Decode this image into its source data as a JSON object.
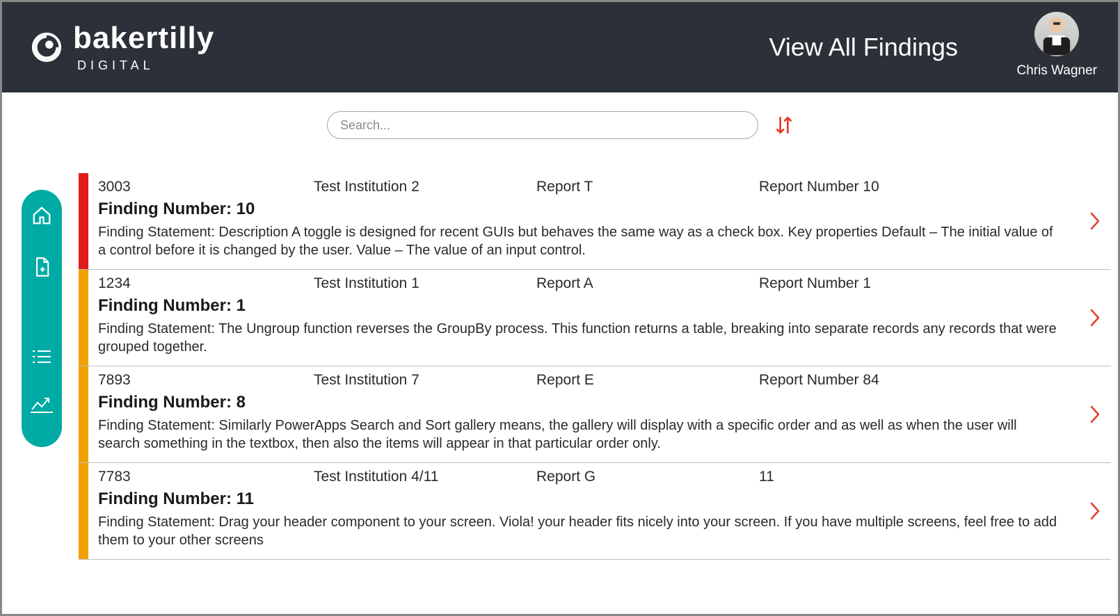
{
  "brand": {
    "name": "bakertilly",
    "sub": "DIGITAL"
  },
  "page_title": "View All Findings",
  "user": {
    "name": "Chris Wagner"
  },
  "search": {
    "placeholder": "Search..."
  },
  "findings": [
    {
      "status_color": "red",
      "id": "3003",
      "institution": "Test Institution 2",
      "report": "Report T",
      "report_number": "Report Number 10",
      "finding_number": "Finding Number: 10",
      "statement": "Finding Statement:  Description A toggle is designed for recent GUIs but behaves the same way as a check box.  Key properties Default – The initial value of a control before it is changed by the user.  Value – The value of an input control."
    },
    {
      "status_color": "orange",
      "id": "1234",
      "institution": "Test Institution 1",
      "report": "Report A",
      "report_number": "Report Number 1",
      "finding_number": "Finding Number: 1",
      "statement": "Finding Statement: The Ungroup function reverses the GroupBy process. This function returns a table, breaking into separate records any records that were grouped together."
    },
    {
      "status_color": "orange",
      "id": "7893",
      "institution": "Test Institution 7",
      "report": "Report E",
      "report_number": "Report Number 84",
      "finding_number": "Finding Number: 8",
      "statement": "Finding Statement: Similarly PowerApps Search and Sort gallery means, the gallery will display with a specific order and as well as when the user will search something in the textbox, then also the items will appear in that particular order only."
    },
    {
      "status_color": "orange",
      "id": "7783",
      "institution": "Test Institution 4/11",
      "report": "Report G",
      "report_number": "11",
      "finding_number": "Finding Number: 11",
      "statement": "Finding Statement: Drag your header component to your screen. Viola! your header fits nicely into your screen. If you have multiple screens, feel free to add them to your other screens"
    }
  ]
}
